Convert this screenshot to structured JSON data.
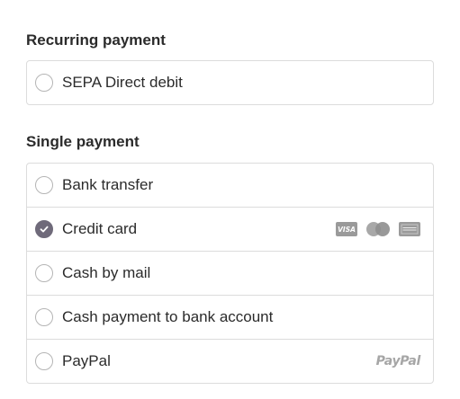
{
  "recurring": {
    "title": "Recurring payment",
    "options": [
      {
        "label": "SEPA Direct debit",
        "checked": false
      }
    ]
  },
  "single": {
    "title": "Single payment",
    "options": [
      {
        "label": "Bank transfer",
        "checked": false
      },
      {
        "label": "Credit card",
        "checked": true,
        "icons": [
          "visa-icon",
          "mastercard-icon",
          "amex-icon"
        ]
      },
      {
        "label": "Cash by mail",
        "checked": false
      },
      {
        "label": "Cash payment to bank account",
        "checked": false
      },
      {
        "label": "PayPal",
        "checked": false,
        "brand_text": "PayPal"
      }
    ]
  },
  "colors": {
    "selected_radio": "#6f6a7a",
    "border": "#dcdcdc",
    "logo_gray": "#9a9a9a"
  }
}
